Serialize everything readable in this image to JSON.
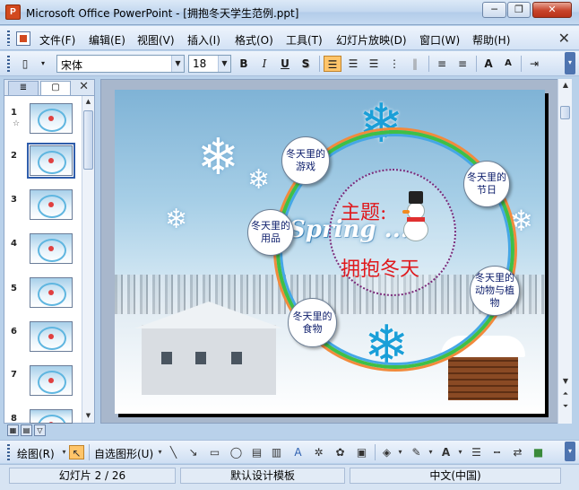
{
  "window": {
    "app_icon": "P",
    "title": "Microsoft Office PowerPoint - [拥抱冬天学生范例.ppt]",
    "minimize": "─",
    "restore": "❐",
    "close": "✕"
  },
  "menu": {
    "items": [
      "文件(F)",
      "编辑(E)",
      "视图(V)",
      "插入(I)",
      "格式(O)",
      "工具(T)",
      "幻灯片放映(D)",
      "窗口(W)",
      "帮助(H)"
    ],
    "close_doc": "✕"
  },
  "format_toolbar": {
    "font_name": "宋体",
    "font_size": "18",
    "bold": "B",
    "italic": "I",
    "underline": "U",
    "shadow": "S",
    "increase_font": "A",
    "decrease_font": "A"
  },
  "slide_panel": {
    "tabs": [
      "outline-icon",
      "slides-icon"
    ],
    "close": "✕",
    "thumbnails": [
      {
        "num": "1",
        "selected": false,
        "has_star": true
      },
      {
        "num": "2",
        "selected": true,
        "has_star": false
      },
      {
        "num": "3",
        "selected": false,
        "has_star": false
      },
      {
        "num": "4",
        "selected": false,
        "has_star": false
      },
      {
        "num": "5",
        "selected": false,
        "has_star": false
      },
      {
        "num": "6",
        "selected": false,
        "has_star": false
      },
      {
        "num": "7",
        "selected": false,
        "has_star": false
      },
      {
        "num": "8",
        "selected": false,
        "has_star": false
      }
    ],
    "star": "☆"
  },
  "slide": {
    "topic_label": "主题:",
    "theme_title": "拥抱冬天",
    "spring_word": "Spring ...",
    "bubbles": {
      "games": "冬天里的游戏",
      "festivals": "冬天里的节日",
      "goods": "冬天里的用品",
      "animals": "冬天里的动物与植物",
      "food": "冬天里的食物"
    }
  },
  "drawing_toolbar": {
    "draw_label": "绘图(R)",
    "autoshapes_label": "自选图形(U)"
  },
  "status": {
    "slide_pos": "幻灯片 2 / 26",
    "template": "默认设计模板",
    "language": "中文(中国)"
  }
}
